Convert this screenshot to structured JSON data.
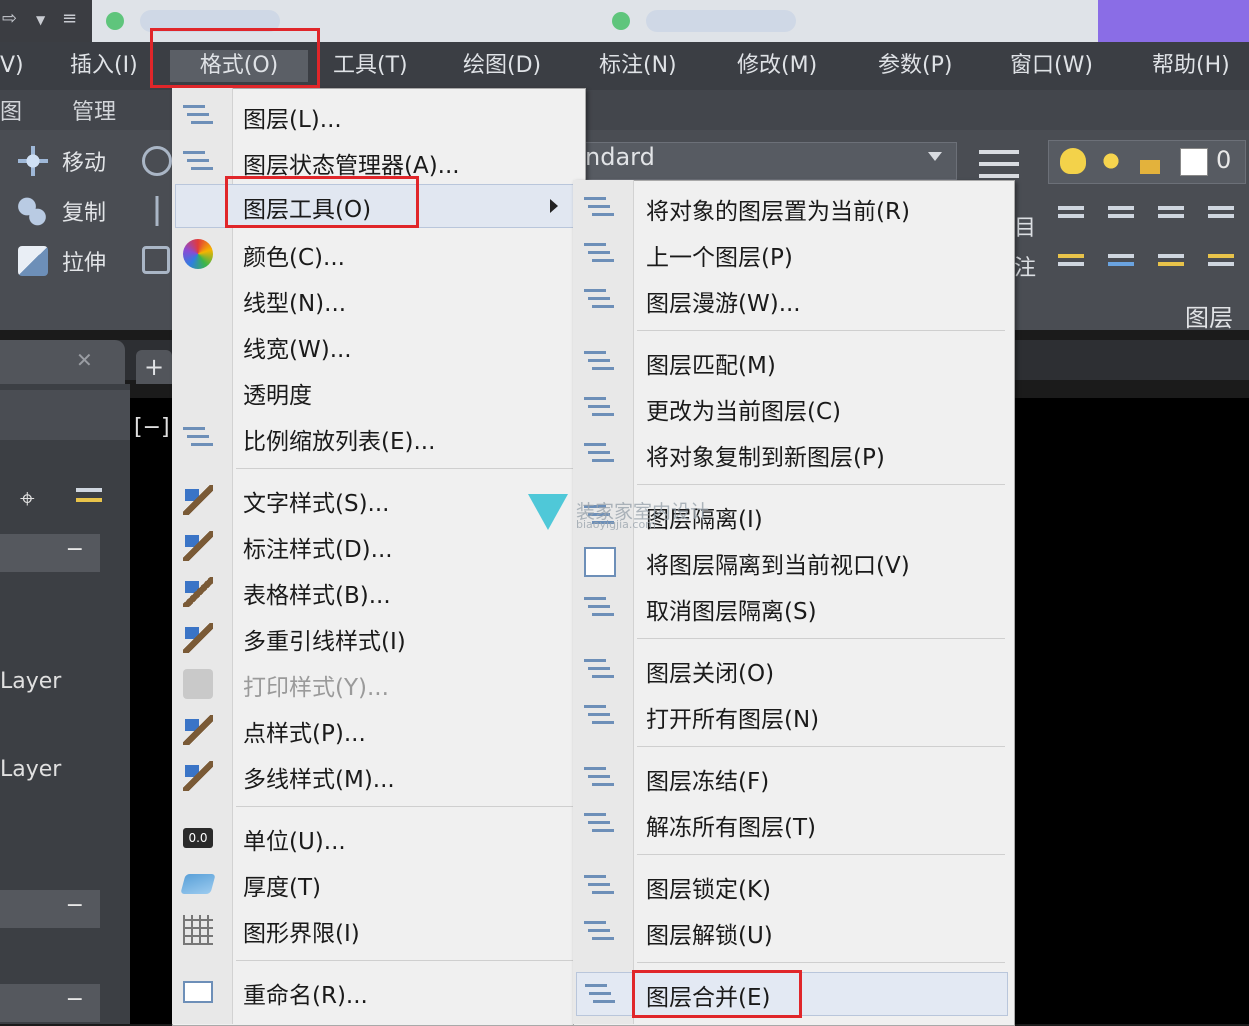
{
  "menubar": {
    "items": [
      {
        "label": "V)"
      },
      {
        "label": "插入(I)"
      },
      {
        "label": "格式(O)"
      },
      {
        "label": "工具(T)"
      },
      {
        "label": "绘图(D)"
      },
      {
        "label": "标注(N)"
      },
      {
        "label": "修改(M)"
      },
      {
        "label": "参数(P)"
      },
      {
        "label": "窗口(W)"
      },
      {
        "label": "帮助(H)"
      }
    ]
  },
  "ribbon": {
    "tabs": [
      "图",
      "管理"
    ],
    "modify": {
      "move": "移动",
      "copy": "复制",
      "stretch": "拉伸"
    },
    "style_combo": "ndard",
    "layer_count": "0",
    "layer_panel_label": "图层",
    "side_chars": [
      "目",
      "注"
    ]
  },
  "palette": {
    "view_label": "[−]",
    "layer_rows": [
      "Layer",
      "Layer"
    ]
  },
  "format_menu": {
    "items": [
      {
        "label": "图层(L)..."
      },
      {
        "label": "图层状态管理器(A)..."
      },
      {
        "label": "图层工具(O)"
      },
      {
        "label": "颜色(C)..."
      },
      {
        "label": "线型(N)..."
      },
      {
        "label": "线宽(W)..."
      },
      {
        "label": "透明度"
      },
      {
        "label": "比例缩放列表(E)..."
      },
      {
        "label": "文字样式(S)..."
      },
      {
        "label": "标注样式(D)..."
      },
      {
        "label": "表格样式(B)..."
      },
      {
        "label": "多重引线样式(I)"
      },
      {
        "label": "打印样式(Y)..."
      },
      {
        "label": "点样式(P)..."
      },
      {
        "label": "多线样式(M)..."
      },
      {
        "label": "单位(U)..."
      },
      {
        "label": "厚度(T)"
      },
      {
        "label": "图形界限(I)"
      },
      {
        "label": "重命名(R)..."
      }
    ],
    "units_icon_text": "0.0"
  },
  "layer_tools_menu": {
    "items": [
      {
        "label": "将对象的图层置为当前(R)"
      },
      {
        "label": "上一个图层(P)"
      },
      {
        "label": "图层漫游(W)..."
      },
      {
        "label": "图层匹配(M)"
      },
      {
        "label": "更改为当前图层(C)"
      },
      {
        "label": "将对象复制到新图层(P)"
      },
      {
        "label": "图层隔离(I)"
      },
      {
        "label": "将图层隔离到当前视口(V)"
      },
      {
        "label": "取消图层隔离(S)"
      },
      {
        "label": "图层关闭(O)"
      },
      {
        "label": "打开所有图层(N)"
      },
      {
        "label": "图层冻结(F)"
      },
      {
        "label": "解冻所有图层(T)"
      },
      {
        "label": "图层锁定(K)"
      },
      {
        "label": "图层解锁(U)"
      },
      {
        "label": "图层合并(E)"
      }
    ]
  },
  "watermark": {
    "text": "装家家室内设计",
    "sub": "biaoyigjia.com"
  },
  "colors": {
    "annotation_red": "#e0262a",
    "menu_bg": "#f0f0f0",
    "highlight": "#e1e7f1"
  }
}
